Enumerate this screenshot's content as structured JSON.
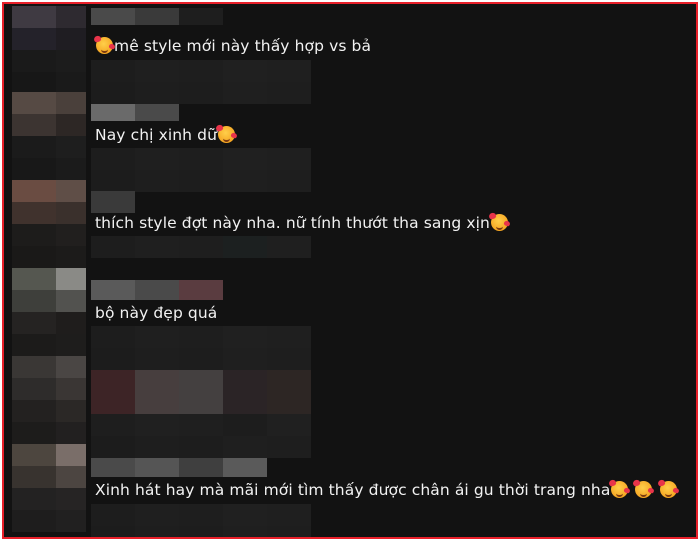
{
  "comments": [
    {
      "text": "mê style mới này thấy hợp vs bả",
      "emoji_before": [
        "smiling-face-with-hearts"
      ],
      "emoji_after": []
    },
    {
      "text": "Nay chị xinh dữ",
      "emoji_before": [],
      "emoji_after": [
        "smiling-face-with-hearts"
      ]
    },
    {
      "text": "thích style đợt này nha. nữ tính thướt tha sang xịn",
      "emoji_before": [],
      "emoji_after": [
        "smiling-face-with-hearts"
      ]
    },
    {
      "text": "bộ này đẹp quá",
      "emoji_before": [],
      "emoji_after": []
    },
    {
      "text": "Xinh hát hay mà mãi mới tìm thấy được chân ái gu thời trang nha",
      "emoji_before": [],
      "emoji_after": [
        "smiling-face-with-hearts",
        "smiling-face-with-hearts",
        "smiling-face-with-hearts"
      ]
    }
  ],
  "colors": {
    "border": "#e8202a",
    "background": "#121212",
    "text": "#f2f2f2"
  }
}
